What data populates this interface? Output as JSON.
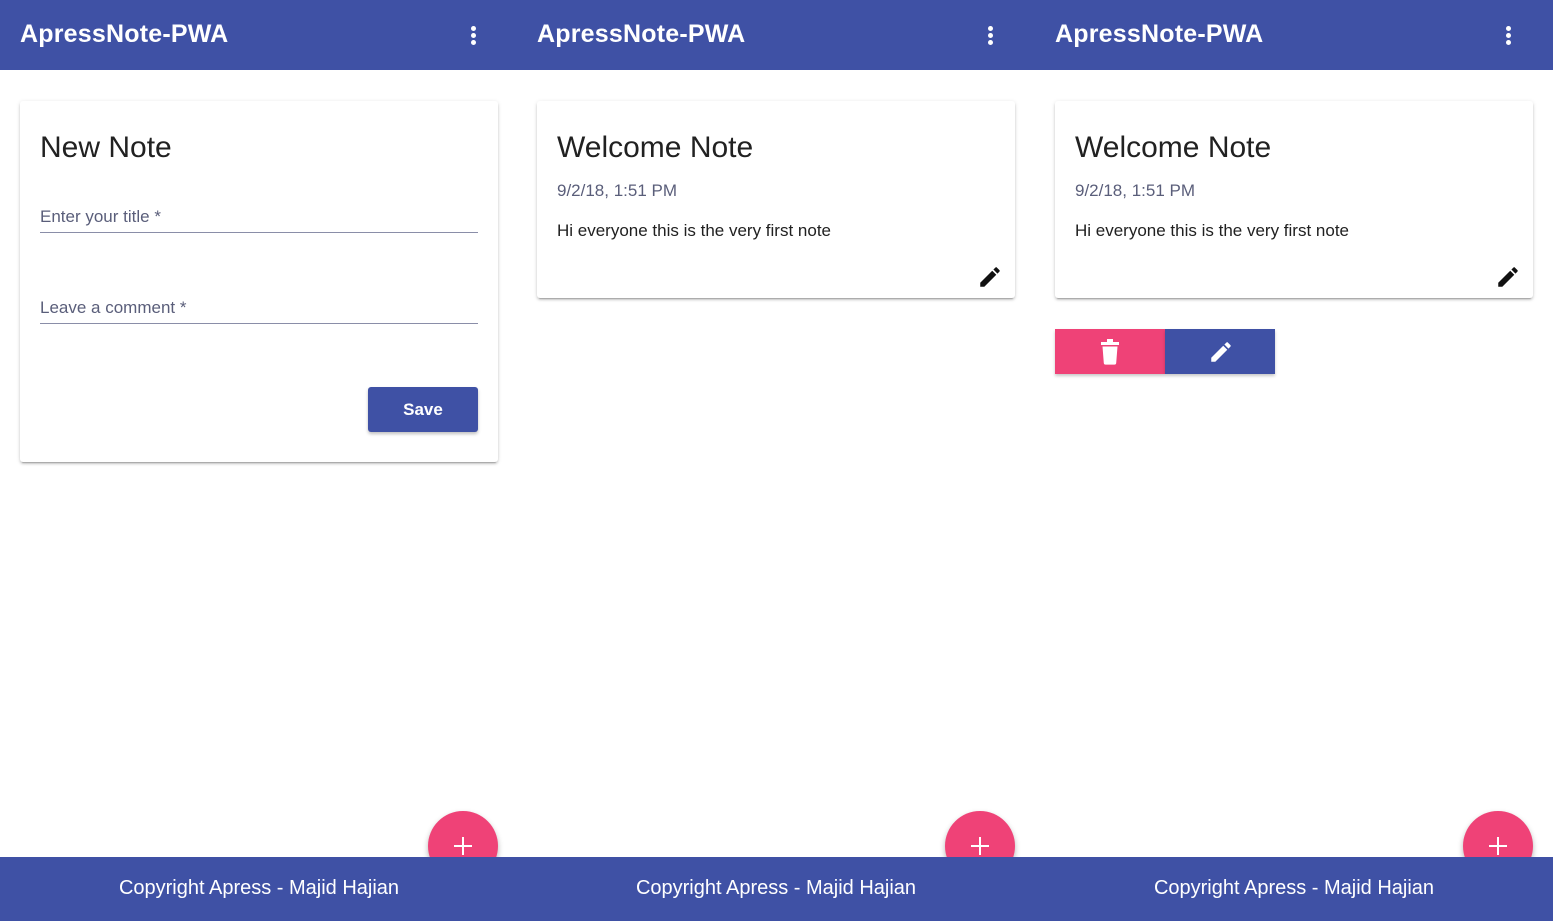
{
  "app": {
    "title": "ApressNote-PWA",
    "footer_text": "Copyright Apress - Majid Hajian"
  },
  "colors": {
    "primary": "#3f51a5",
    "accent": "#ef4277"
  },
  "new_note_form": {
    "heading": "New Note",
    "title_placeholder": "Enter your title *",
    "comment_placeholder": "Leave a comment *",
    "save_label": "Save"
  },
  "note": {
    "title": "Welcome Note",
    "date": "9/2/18, 1:51 PM",
    "body": "Hi everyone this is the very first note"
  },
  "icons": {
    "menu": "more-vert-icon",
    "edit": "pencil-icon",
    "delete": "trash-icon",
    "add": "plus-icon"
  }
}
